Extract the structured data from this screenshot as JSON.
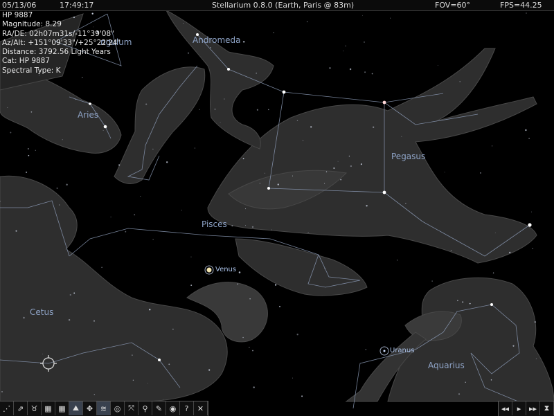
{
  "topbar": {
    "date": "05/13/06",
    "time": "17:49:17",
    "title": "Stellarium 0.8.0 (Earth, Paris @ 83m)",
    "fov": "FOV=60°",
    "fps": "FPS=44.25"
  },
  "object_info": {
    "name": "HP 9887",
    "magnitude": "Magnitude: 8.29",
    "ra_de": "RA/DE: 02h07m31s/-11°39'08\"",
    "az_alt": "Az/Alt: +151°09'33\"/+25°22'24\"",
    "distance": "Distance: 3792.56 Light Years",
    "catalog": "Cat: HP 9887",
    "spectral_type": "Spectral Type: K"
  },
  "constellations": {
    "triangulum": "ngulum",
    "andromeda": "Andromeda",
    "aries": "Aries",
    "pegasus": "Pegasus",
    "pisces": "Pisces",
    "cetus": "Cetus",
    "aquarius": "Aquarius"
  },
  "planets": {
    "venus": "Venus",
    "uranus": "Uranus"
  },
  "colors": {
    "constellation_lines": "#8b9ab5",
    "constellation_labels": "#8ea3c6",
    "venus": "#f3e6b0",
    "selection_marker": "#d8d8d8",
    "toolbar_active": "#39414e"
  },
  "toolbar": [
    {
      "icon": "constellation-lines-icon",
      "glyph": "⋰"
    },
    {
      "icon": "constellation-names-icon",
      "glyph": "⇗"
    },
    {
      "icon": "constellation-art-icon",
      "glyph": "♉"
    },
    {
      "icon": "azimuth-grid-icon",
      "glyph": "▦"
    },
    {
      "icon": "equatorial-grid-icon",
      "glyph": "▦"
    },
    {
      "icon": "ground-icon",
      "glyph": "⛰",
      "active": true
    },
    {
      "icon": "cardinal-points-icon",
      "glyph": "✥"
    },
    {
      "icon": "atmosphere-icon",
      "glyph": "≋",
      "active": true
    },
    {
      "icon": "nebulae-icon",
      "glyph": "◎"
    },
    {
      "icon": "telescope-mount-icon",
      "glyph": "⤧"
    },
    {
      "icon": "search-icon",
      "glyph": "⚲"
    },
    {
      "icon": "configuration-icon",
      "glyph": "✎"
    },
    {
      "icon": "night-mode-icon",
      "glyph": "◉"
    },
    {
      "icon": "help-icon",
      "glyph": "?"
    },
    {
      "icon": "quit-icon",
      "glyph": "✕"
    }
  ],
  "time_controls": [
    {
      "icon": "rewind-icon",
      "glyph": "◂◂"
    },
    {
      "icon": "play-icon",
      "glyph": "▸"
    },
    {
      "icon": "fast-forward-icon",
      "glyph": "▸▸"
    },
    {
      "icon": "real-time-icon",
      "glyph": "⧗"
    }
  ]
}
